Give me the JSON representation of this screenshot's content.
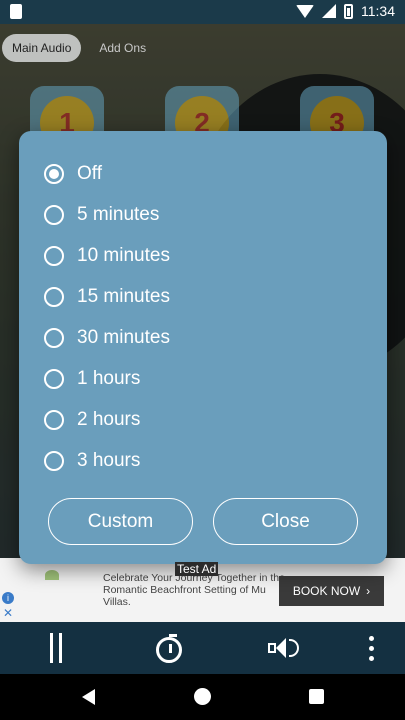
{
  "status_bar": {
    "time": "11:34"
  },
  "tabs": [
    {
      "label": "Main Audio"
    },
    {
      "label": "Add Ons"
    }
  ],
  "background_numbers": [
    "1",
    "2",
    "3"
  ],
  "dialog": {
    "options": [
      {
        "label": "Off",
        "checked": true
      },
      {
        "label": "5 minutes",
        "checked": false
      },
      {
        "label": "10 minutes",
        "checked": false
      },
      {
        "label": "15 minutes",
        "checked": false
      },
      {
        "label": "30 minutes",
        "checked": false
      },
      {
        "label": "1 hours",
        "checked": false
      },
      {
        "label": "2 hours",
        "checked": false
      },
      {
        "label": "3 hours",
        "checked": false
      }
    ],
    "custom_label": "Custom",
    "close_label": "Close"
  },
  "ad": {
    "label": "Test Ad",
    "text": "Celebrate Your Journey Together in the Romantic Beachfront Setting of Mu Villas.",
    "button": "BOOK NOW",
    "info_icon": "info-icon",
    "close_icon": "close-icon"
  },
  "player": {
    "icons": [
      "pause-icon",
      "timer-icon",
      "volume-icon",
      "more-vert-icon"
    ]
  },
  "colors": {
    "dialog_bg": "#6a9ebc",
    "player_bg": "#143041",
    "accent_yellow": "#e7b91c"
  }
}
